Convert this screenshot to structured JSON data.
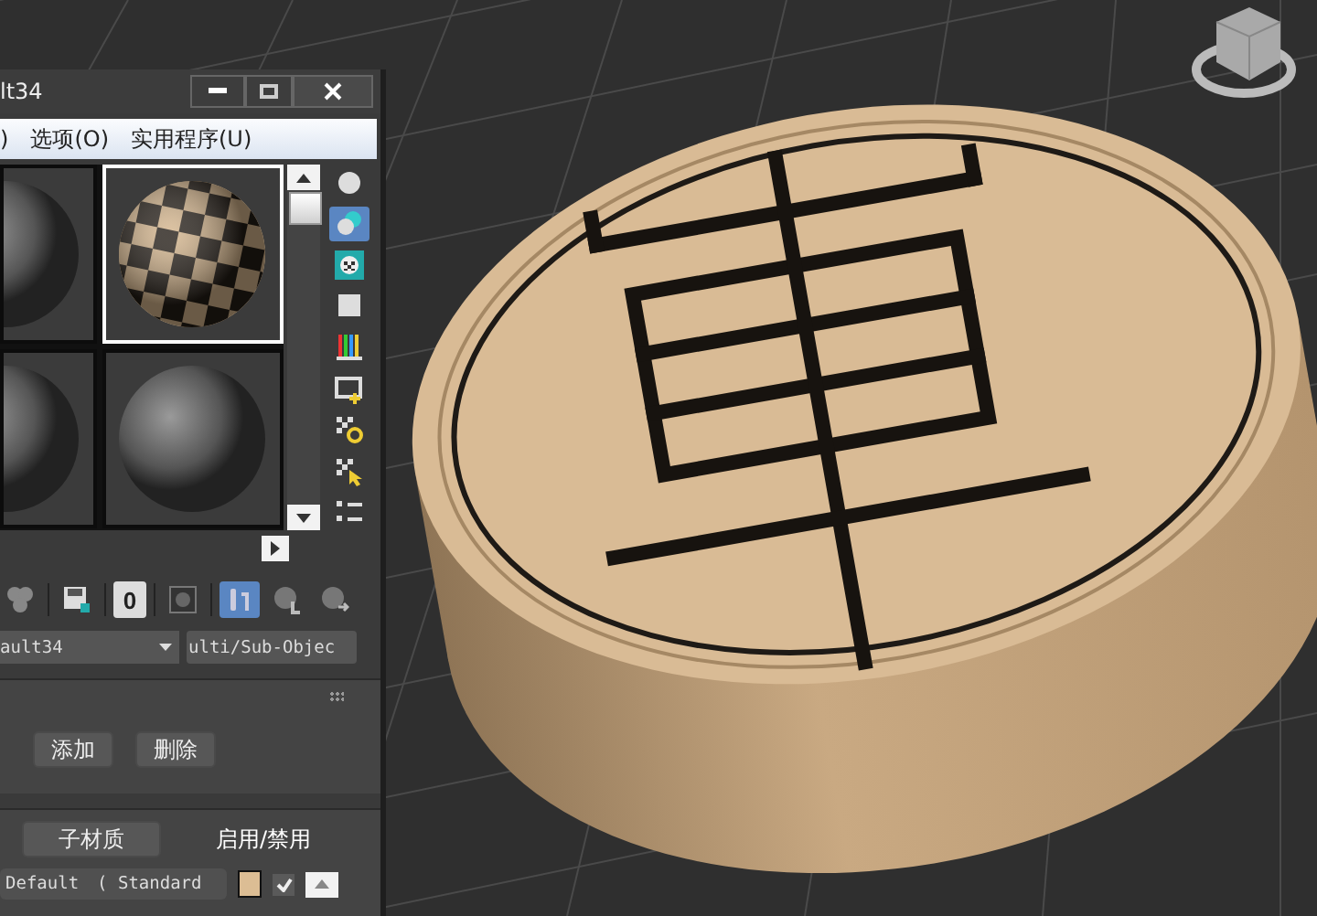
{
  "material_editor": {
    "title": "lt34",
    "menu": [
      {
        "label": ")"
      },
      {
        "label": "选项(O)"
      },
      {
        "label": "实用程序(U)"
      }
    ],
    "sample_slots": [
      {
        "kind": "plain",
        "selected": false
      },
      {
        "kind": "checker",
        "selected": true
      },
      {
        "kind": "plain",
        "selected": false
      },
      {
        "kind": "plain",
        "selected": false
      }
    ],
    "side_tools": [
      {
        "kind": "sphere",
        "selected": false
      },
      {
        "kind": "spheres",
        "selected": true
      },
      {
        "kind": "checker",
        "selected": false
      },
      {
        "kind": "square",
        "selected": false
      },
      {
        "kind": "bars",
        "selected": false
      },
      {
        "kind": "film",
        "selected": false
      },
      {
        "kind": "gear",
        "selected": false
      },
      {
        "kind": "pointer",
        "selected": false
      },
      {
        "kind": "list",
        "selected": false
      }
    ],
    "toolbar": [
      {
        "kind": "cluster",
        "selected": false
      },
      {
        "kind": "save",
        "selected": false
      },
      {
        "kind": "text",
        "label": "0",
        "selected": false
      },
      {
        "kind": "square",
        "selected": false
      },
      {
        "kind": "pipe",
        "selected": true
      },
      {
        "kind": "checkerl",
        "selected": false
      },
      {
        "kind": "checkerarrow",
        "selected": false
      }
    ],
    "material_name": "ault34",
    "material_type": "ulti/Sub-Objec",
    "buttons": [
      {
        "label": "添加"
      },
      {
        "label": "删除"
      }
    ],
    "sub_header": {
      "column_1": "子材质",
      "column_2": "启用/禁用"
    },
    "rows": [
      {
        "name": "Default",
        "type": "( Standard",
        "color": "#dcbd94",
        "enabled": true
      }
    ]
  }
}
